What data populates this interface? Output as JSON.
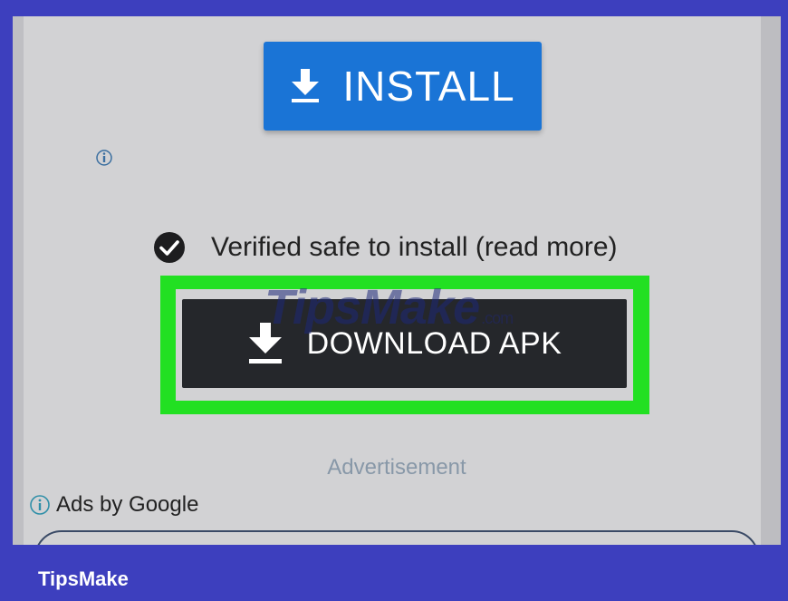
{
  "install_button": {
    "label": "INSTALL",
    "icon": "download-icon",
    "color": "#1a74d6"
  },
  "info_icon": "info-icon",
  "verified": {
    "text": "Verified safe to install (read more)",
    "icon": "check-circle-icon"
  },
  "download_button": {
    "label": "DOWNLOAD APK",
    "icon": "download-icon",
    "color": "#25272b"
  },
  "highlight_color": "#22e022",
  "watermark": {
    "brand": "TipsMake",
    "suffix": ".com"
  },
  "advertisement_label": "Advertisement",
  "ads_by": {
    "text": "Ads by Google",
    "icon": "info-icon"
  },
  "footer": {
    "brand": "TipsMake"
  },
  "colors": {
    "frame": "#3d3fbe",
    "screen": "#d2d2d4"
  }
}
